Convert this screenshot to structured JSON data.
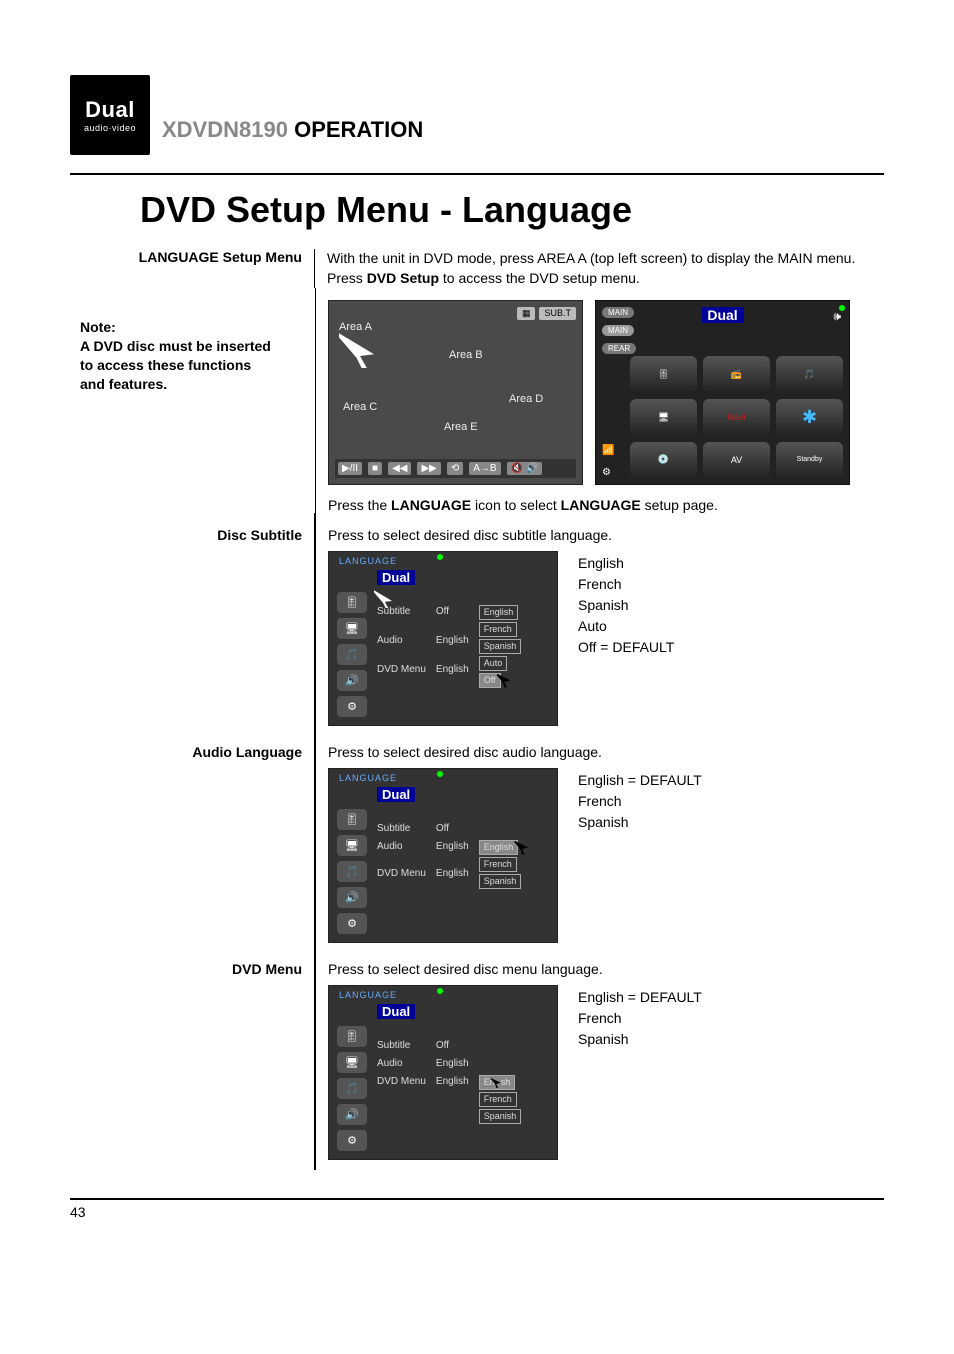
{
  "header": {
    "logo_main": "Dual",
    "logo_sub": "audio·video",
    "model": "XDVDN8190",
    "operation": "OPERATION"
  },
  "title": "DVD Setup Menu - Language",
  "sections": {
    "setup_label": "LANGUAGE Setup Menu",
    "intro_part1": "With the unit in DVD mode, press AREA A (top left screen) to display the MAIN menu. Press ",
    "intro_bold": "DVD Setup",
    "intro_part2": " to access the DVD setup menu.",
    "note_title": "Note:",
    "note_body1": "A DVD disc must be inserted",
    "note_body2": "to access these functions",
    "note_body3": "and features.",
    "press_lang_1": "Press the ",
    "press_lang_b1": "LANGUAGE",
    "press_lang_2": " icon to select ",
    "press_lang_b2": "LANGUAGE",
    "press_lang_3": " setup page.",
    "disc_subtitle_label": "Disc Subtitle",
    "disc_subtitle_text": "Press to select desired disc subtitle language.",
    "disc_subtitle_options": [
      "English",
      "French",
      "Spanish",
      "Auto",
      "Off = DEFAULT"
    ],
    "audio_label": "Audio Language",
    "audio_text": "Press to select desired disc audio language.",
    "audio_options": [
      "English = DEFAULT",
      "French",
      "Spanish"
    ],
    "dvdmenu_label": "DVD Menu",
    "dvdmenu_text": "Press to select desired disc menu language.",
    "dvdmenu_options": [
      "English = DEFAULT",
      "French",
      "Spanish"
    ]
  },
  "shot1": {
    "sub_t": "SUB.T",
    "areas": {
      "a": "Area A",
      "b": "Area B",
      "c": "Area C",
      "d": "Area D",
      "e": "Area E"
    },
    "playbar": [
      "▶/II",
      "■",
      "◀◀",
      "▶▶",
      "⟲",
      "A→B",
      "🔇 🔊"
    ]
  },
  "shot_main": {
    "pill1": "MAIN",
    "pill2": "MAIN",
    "pill3": "REAR",
    "dual": "Dual",
    "cells": [
      "",
      "",
      "",
      "",
      "Navi",
      "✱",
      "",
      "",
      "Standby"
    ]
  },
  "lm": {
    "tab": "LANGUAGE",
    "dual": "Dual",
    "rows": {
      "subtitle_k": "Subtitle",
      "subtitle_v": "Off",
      "audio_k": "Audio",
      "audio_v": "English",
      "dvd_k": "DVD Menu",
      "dvd_v": "English"
    },
    "popup1": [
      "English",
      "French",
      "Spanish",
      "Auto",
      "Off"
    ],
    "popup2": [
      "English",
      "French",
      "Spanish"
    ],
    "popup3": [
      "English",
      "French",
      "Spanish"
    ]
  },
  "page_number": "43"
}
